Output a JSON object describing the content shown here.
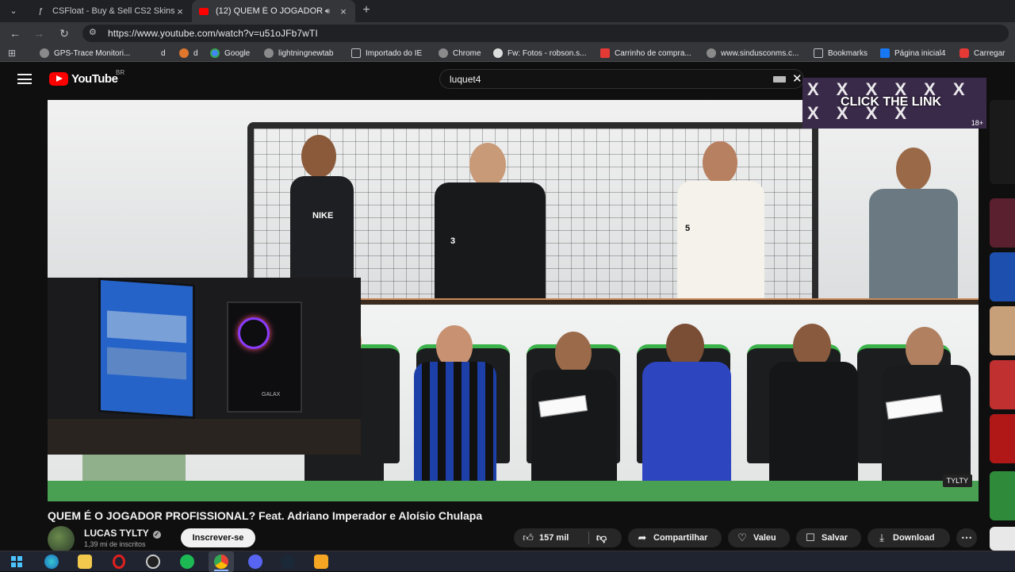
{
  "browser": {
    "tabs": [
      {
        "title": "CSFloat - Buy & Sell CS2 Skins"
      },
      {
        "title": "(12) QUEM É O JOGADOR P"
      }
    ],
    "url": "https://www.youtube.com/watch?v=u51oJFb7wTI",
    "bookmarks": [
      {
        "label": "GPS-Trace Monitori..."
      },
      {
        "label": "d"
      },
      {
        "label": "d"
      },
      {
        "label": "Google"
      },
      {
        "label": "lightningnewtab"
      },
      {
        "label": "Importado do IE"
      },
      {
        "label": "Chrome"
      },
      {
        "label": "Fw: Fotos - robson.s..."
      },
      {
        "label": "Carrinho de compra..."
      },
      {
        "label": "www.sindusconms.c..."
      },
      {
        "label": "Bookmarks"
      },
      {
        "label": "Página inicial4"
      },
      {
        "label": "Carregar"
      }
    ]
  },
  "youtube": {
    "logo": "YouTube",
    "region": "BR",
    "search_value": "luquet4",
    "ad": {
      "text": "CLICK THE LINK",
      "xs": "X X X X X X X X X X",
      "age": "18+"
    }
  },
  "video": {
    "title": "QUEM É O JOGADOR PROFISSIONAL? Feat. Adriano Imperador e Aloísio Chulapa",
    "channel": "LUCAS TYLTY",
    "subscribers": "1,39 mi de inscritos",
    "subscribe_label": "Inscrever-se",
    "likes": "157 mil",
    "share_label": "Compartilhar",
    "thanks_label": "Valeu",
    "save_label": "Salvar",
    "download_label": "Download",
    "watermark": "TYLTY",
    "jersey_text": "NIKE",
    "jersey_numbers": [
      "3",
      "5"
    ],
    "webcam_brand": "GALAX"
  },
  "colors": {
    "yt_red": "#ff0000",
    "grass": "#4aa052",
    "chair_trim": "#3bb34a"
  }
}
